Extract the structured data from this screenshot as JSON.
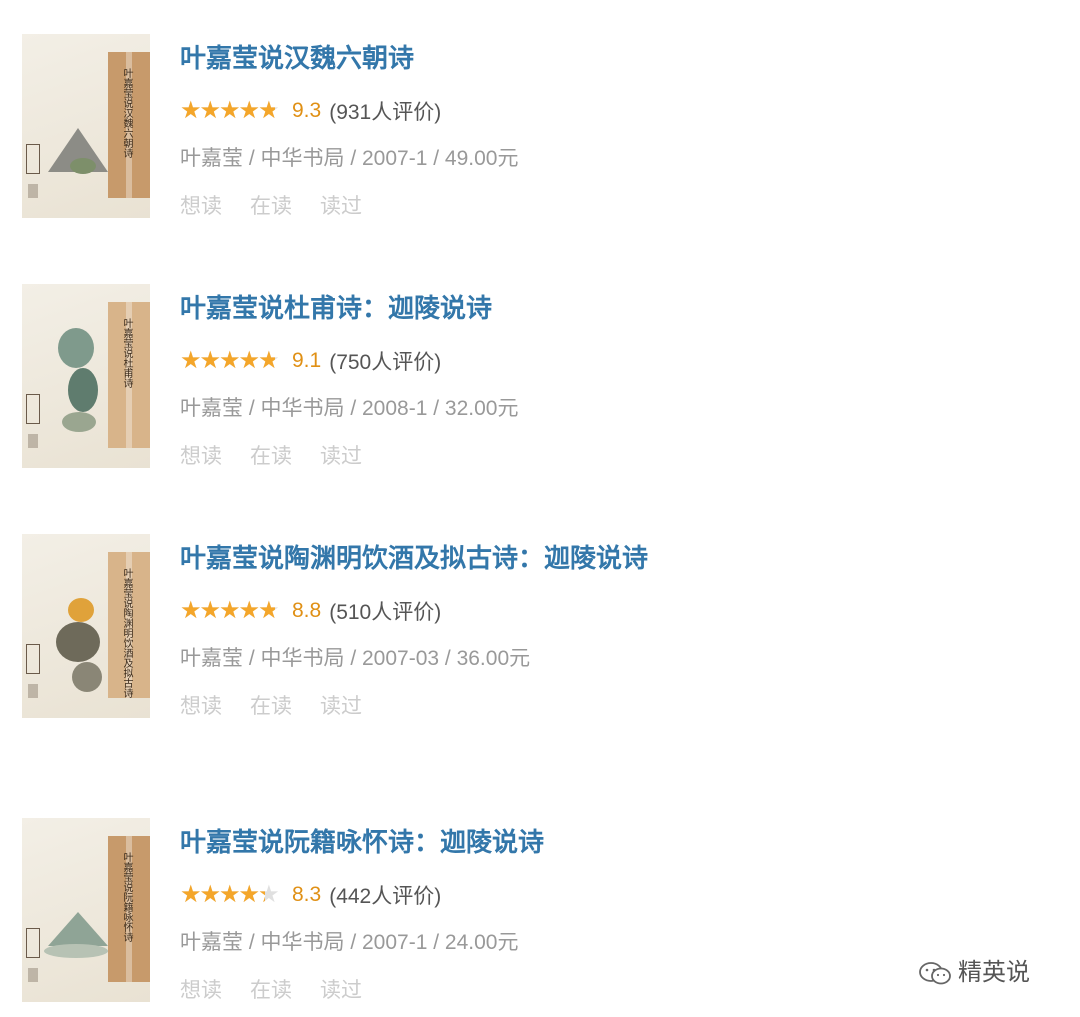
{
  "books": [
    {
      "title": "叶嘉莹说汉魏六朝诗",
      "rating": 9.3,
      "score_text": "9.3",
      "count_text": "(931人评价)",
      "pub": "叶嘉莹 / 中华书局 / 2007-1 / 49.00元",
      "cover_text": "叶嘉莹说汉魏六朝诗"
    },
    {
      "title": "叶嘉莹说杜甫诗：迦陵说诗",
      "rating": 9.1,
      "score_text": "9.1",
      "count_text": "(750人评价)",
      "pub": "叶嘉莹 / 中华书局 / 2008-1 / 32.00元",
      "cover_text": "叶嘉莹说杜甫诗"
    },
    {
      "title": "叶嘉莹说陶渊明饮酒及拟古诗：迦陵说诗",
      "rating": 8.8,
      "score_text": "8.8",
      "count_text": "(510人评价)",
      "pub": "叶嘉莹 / 中华书局 / 2007-03 / 36.00元",
      "cover_text": "叶嘉莹说陶渊明饮酒及拟古诗"
    },
    {
      "title": "叶嘉莹说阮籍咏怀诗：迦陵说诗",
      "rating": 8.3,
      "score_text": "8.3",
      "count_text": "(442人评价)",
      "pub": "叶嘉莹 / 中华书局 / 2007-1 / 24.00元",
      "cover_text": "叶嘉莹说阮籍咏怀诗"
    }
  ],
  "actions": {
    "want": "想读",
    "reading": "在读",
    "read": "读过"
  },
  "watermark": {
    "text": "精英说",
    "icon": "wechat-icon"
  },
  "colors": {
    "title": "#3377aa",
    "star": "#f4a62a",
    "score": "#e09015",
    "meta": "#999999",
    "action": "#cccccc"
  }
}
